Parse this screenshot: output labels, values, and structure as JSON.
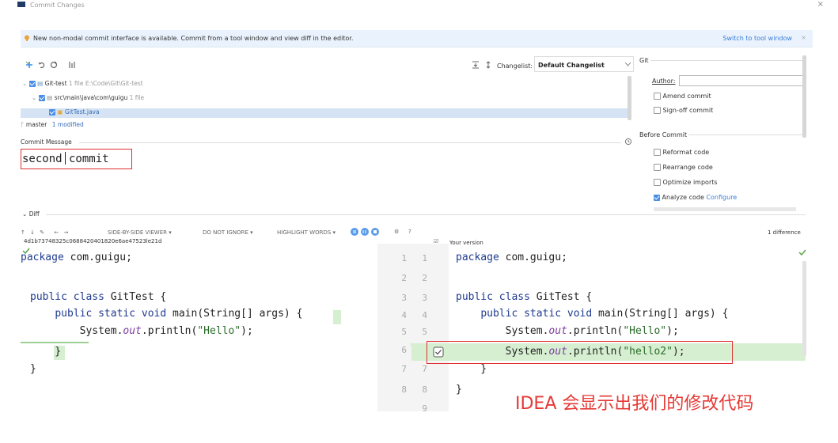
{
  "window": {
    "title": "Commit Changes",
    "close": "×"
  },
  "banner": {
    "text": "New non-modal commit interface is available. Commit from a tool window and view diff in the editor.",
    "switch_link": "Switch to tool window",
    "close": "×"
  },
  "toolbar": {
    "changelist_label": "Changelist:",
    "changelist_value": "Default Changelist"
  },
  "tree": {
    "root_name": "Git-test",
    "root_meta": "1 file  E:\\Code\\Git\\Git-test",
    "folder_name": "src\\main\\java\\com\\guigu",
    "folder_meta": "1 file",
    "file_name": "GitTest.java"
  },
  "status": {
    "branch": "master",
    "modified": "1 modified"
  },
  "commit_message": {
    "label": "Commit Message",
    "value": "second commit"
  },
  "git_panel": {
    "section": "Git",
    "author_label": "Author:",
    "amend": "Amend commit",
    "signoff": "Sign-off commit",
    "before_commit": "Before Commit",
    "options": [
      {
        "label": "Reformat code",
        "checked": false
      },
      {
        "label": "Rearrange code",
        "checked": false
      },
      {
        "label": "Optimize imports",
        "checked": false
      },
      {
        "label": "Analyze code",
        "checked": true,
        "link": "Configure"
      }
    ]
  },
  "diff": {
    "label": "Diff",
    "viewer": "SIDE-BY-SIDE VIEWER",
    "ignore": "DO NOT IGNORE",
    "highlight": "HIGHLIGHT WORDS",
    "help": "?",
    "differences": "1 difference",
    "left_rev": "4d1b73748325c0688420401820e6ae47523le21d",
    "right_rev": "Your version",
    "left_lines": [
      "package com.guigu;",
      "",
      "public class GitTest {",
      "    public static void main(String[] args) {",
      "        System.out.println(\"Hello\");",
      "    }",
      "}"
    ],
    "right_lines": [
      "package com.guigu;",
      "",
      "public class GitTest {",
      "    public static void main(String[] args) {",
      "        System.out.println(\"Hello\");",
      "        System.out.println(\"hello2\");",
      "    }",
      "}"
    ],
    "left_numbers": [
      "1",
      "2",
      "3",
      "4",
      "5",
      "6",
      "7",
      "8"
    ],
    "right_numbers": [
      "1",
      "2",
      "3",
      "4",
      "5",
      "",
      "7",
      "8",
      "9"
    ]
  },
  "annotation": "IDEA 会显示出我们的修改代码",
  "colors": {
    "accent": "#3b7dd8",
    "highlight_red": "#e03030",
    "added_green": "#d6efd1"
  }
}
